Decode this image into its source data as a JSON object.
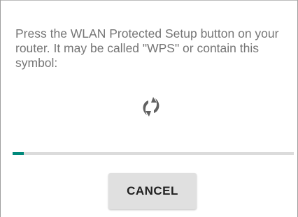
{
  "dialog": {
    "message": "Press the WLAN Protected Setup button on your router. It may be called \"WPS\" or contain this symbol:",
    "icon": "wps-icon",
    "progress_percent": 4,
    "cancel_label": "CANCEL"
  },
  "colors": {
    "message_text": "#757575",
    "icon": "#616161",
    "progress_fill": "#00897b",
    "progress_track": "#dbdbdb",
    "button_background": "#e0e0e0",
    "button_text": "#212121"
  }
}
